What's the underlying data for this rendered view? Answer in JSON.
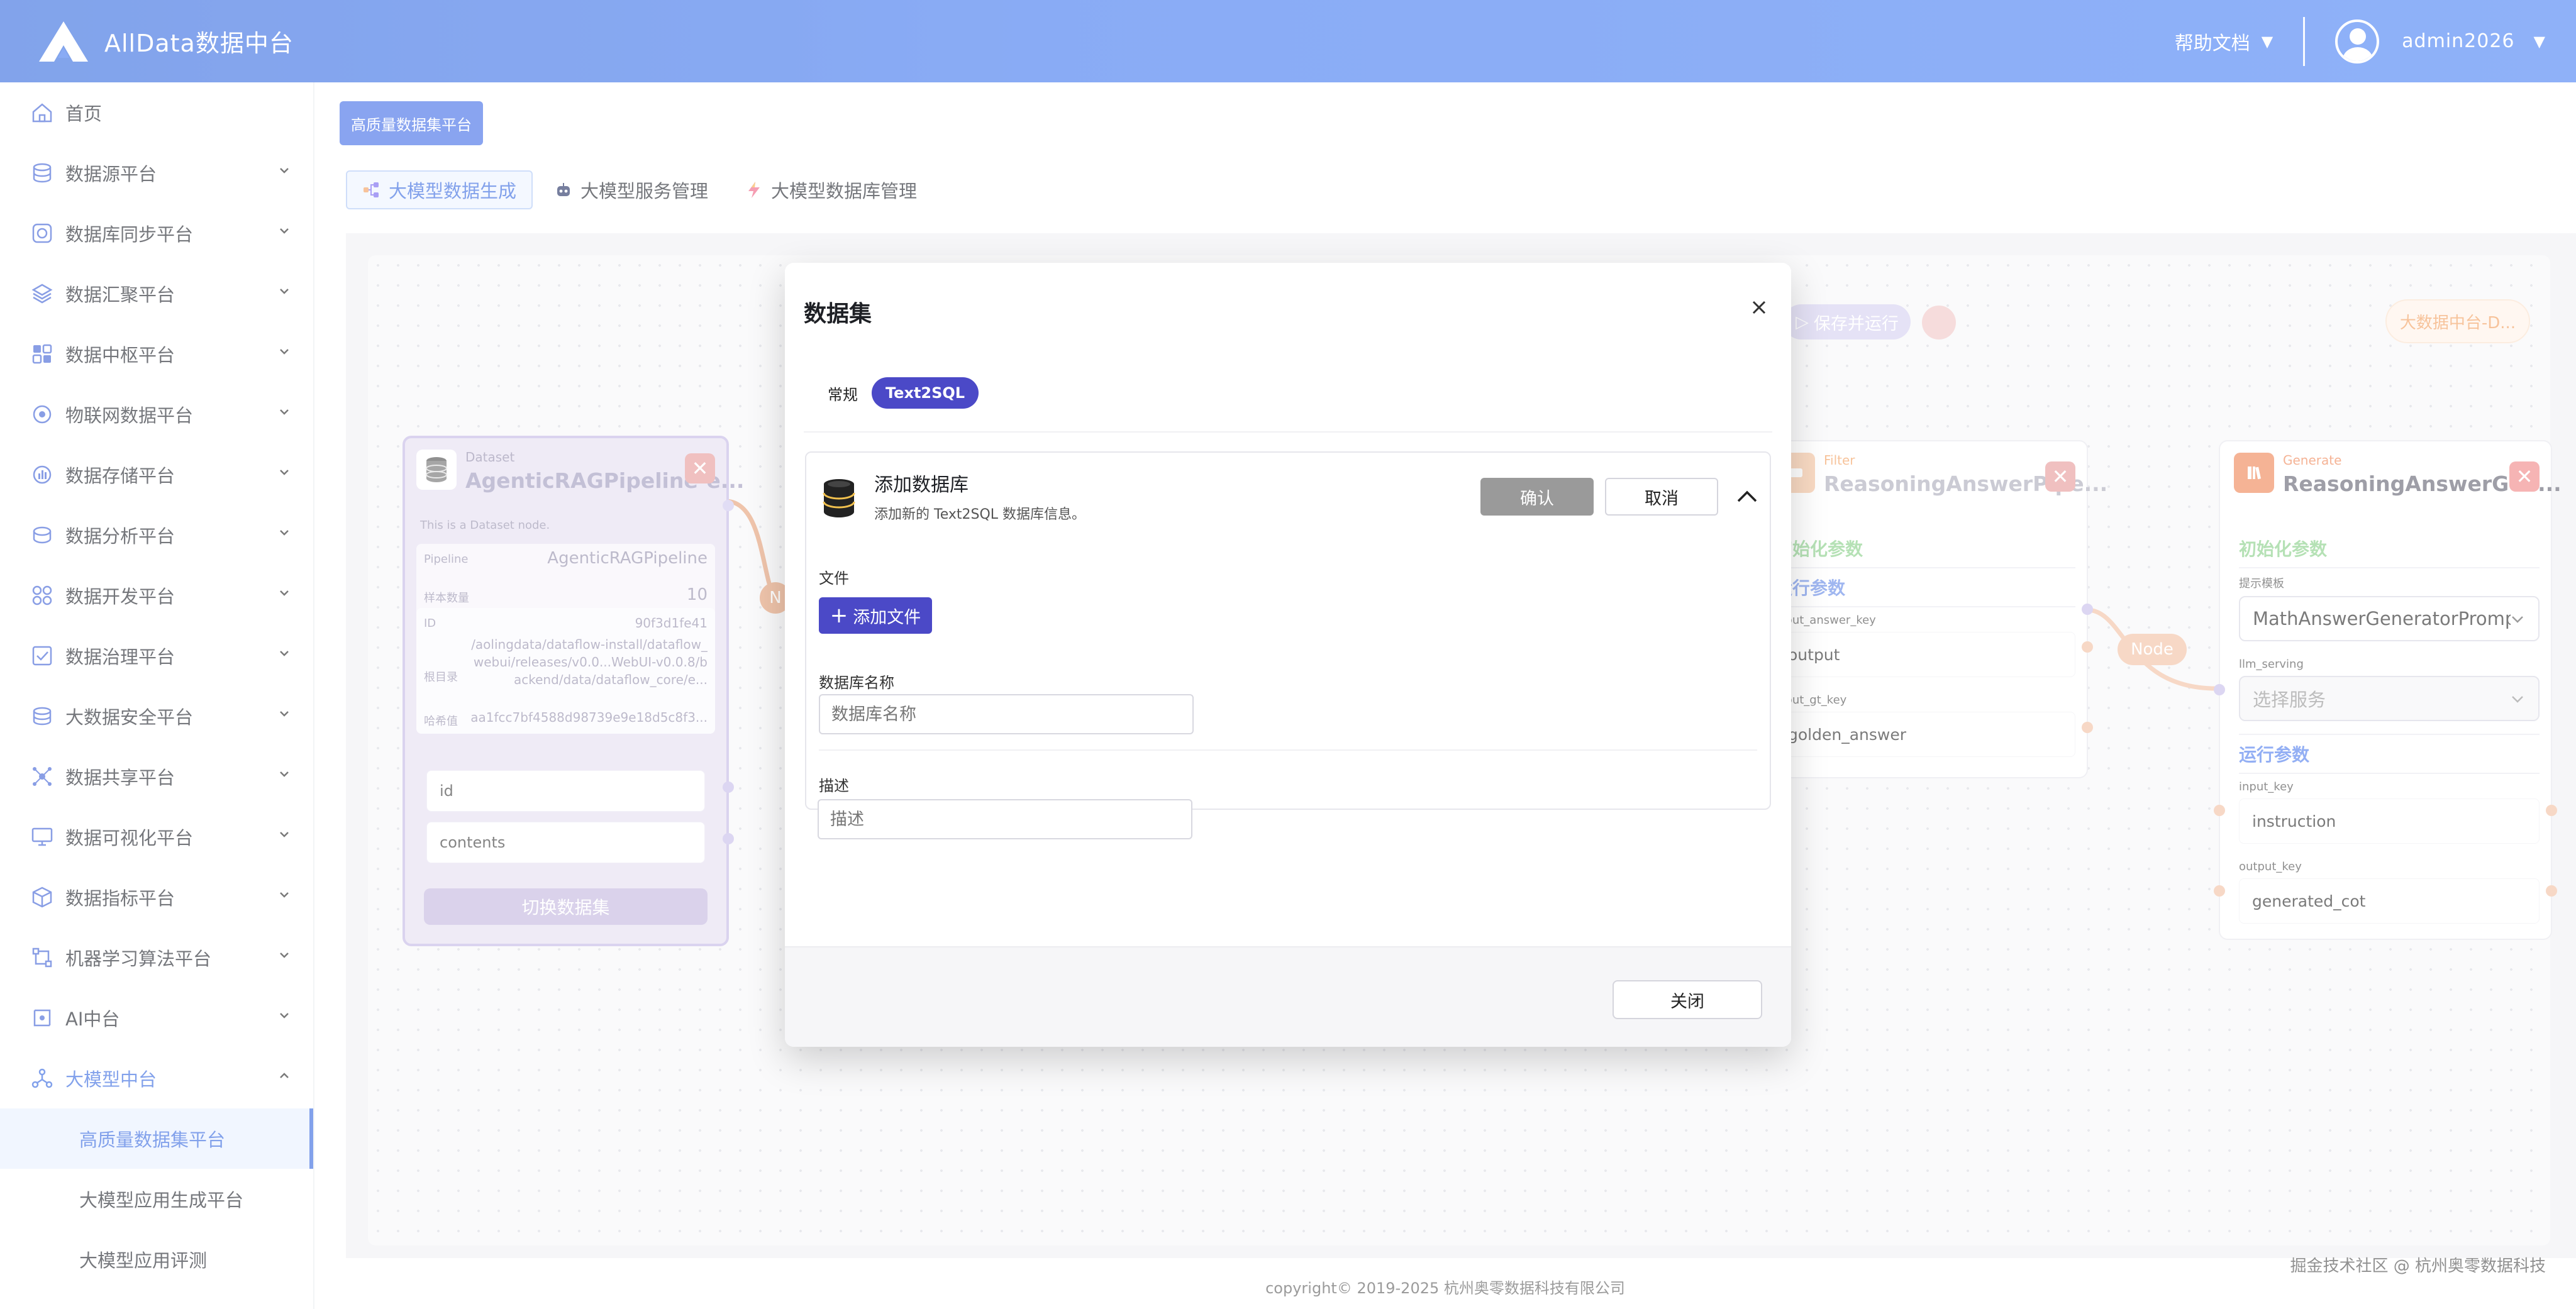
{
  "header": {
    "title": "AllData数据中台",
    "help_label": "帮助文档",
    "username": "admin2026"
  },
  "sidebar": {
    "items": [
      {
        "label": "首页",
        "icon": "home-icon"
      },
      {
        "label": "数据源平台",
        "icon": "database-icon"
      },
      {
        "label": "数据库同步平台",
        "icon": "sync-icon"
      },
      {
        "label": "数据汇聚平台",
        "icon": "layers-icon"
      },
      {
        "label": "数据中枢平台",
        "icon": "grid-icon"
      },
      {
        "label": "物联网数据平台",
        "icon": "iot-icon"
      },
      {
        "label": "数据存储平台",
        "icon": "storage-icon"
      },
      {
        "label": "数据分析平台",
        "icon": "analysis-icon"
      },
      {
        "label": "数据开发平台",
        "icon": "apps-icon"
      },
      {
        "label": "数据治理平台",
        "icon": "governance-icon"
      },
      {
        "label": "大数据安全平台",
        "icon": "security-icon"
      },
      {
        "label": "数据共享平台",
        "icon": "share-icon"
      },
      {
        "label": "数据可视化平台",
        "icon": "monitor-icon"
      },
      {
        "label": "数据指标平台",
        "icon": "cube-icon"
      },
      {
        "label": "机器学习算法平台",
        "icon": "ml-icon"
      },
      {
        "label": "AI中台",
        "icon": "ai-icon"
      },
      {
        "label": "大模型中台",
        "icon": "llm-icon"
      }
    ],
    "sub_items": [
      {
        "label": "高质量数据集平台"
      },
      {
        "label": "大模型应用生成平台"
      },
      {
        "label": "大模型应用评测"
      }
    ]
  },
  "main": {
    "tag_button": "高质量数据集平台",
    "tabs": [
      {
        "label": "大模型数据生成"
      },
      {
        "label": "大模型服务管理"
      },
      {
        "label": "大模型数据库管理"
      }
    ]
  },
  "canvas": {
    "save_run_label": "保存并运行",
    "right_tag": "大数据中台-D...",
    "dataset_node": {
      "type": "Dataset",
      "name": "AgenticRAGPipeline-e...",
      "desc": "This is a Dataset node.",
      "pipeline_label": "Pipeline",
      "pipeline_value": "AgenticRAGPipeline",
      "sample_label": "样本数量",
      "sample_value": "10",
      "id_label": "ID",
      "id_value": "90f3d1fe41",
      "root_label": "根目录",
      "root_value": "/aolingdata/dataflow-install/dataflow_webui/releases/v0.0...WebUI-v0.0.8/backend/data/dataflow_core/e...",
      "hash_label": "哈希值",
      "hash_value": "aa1fcc7bf4588d98739e9e18d5c8f3...",
      "fields": [
        "id",
        "contents"
      ],
      "switch_label": "切换数据集"
    },
    "filter_node": {
      "type": "Filter",
      "name": "ReasoningAnswerPipe...",
      "init_params": "初始化参数",
      "run_params": "运行参数",
      "k1": "input_answer_key",
      "v1": "output",
      "k2": "input_gt_key",
      "v2": "golden_answer"
    },
    "generate_node": {
      "type": "Generate",
      "name": "ReasoningAnswerGen...",
      "init_params": "初始化参数",
      "prompt_label": "提示模板",
      "prompt_value": "MathAnswerGeneratorPromp",
      "serving_label": "llm_serving",
      "serving_placeholder": "选择服务",
      "run_params": "运行参数",
      "k1": "input_key",
      "v1": "instruction",
      "k2": "output_key",
      "v2": "generated_cot"
    },
    "node_pill_label": "Node",
    "left_pill_label": "N"
  },
  "modal": {
    "title": "数据集",
    "tabs": [
      {
        "label": "常规"
      },
      {
        "label": "Text2SQL"
      }
    ],
    "card": {
      "title": "添加数据库",
      "desc": "添加新的 Text2SQL 数据库信息。",
      "confirm": "确认",
      "cancel": "取消",
      "file_label": "文件",
      "add_file": "添加文件",
      "db_name_label": "数据库名称",
      "db_name_placeholder": "数据库名称",
      "desc_label": "描述",
      "desc_placeholder": "描述"
    },
    "close_label": "关闭"
  },
  "footer": {
    "copyright": "copyright© 2019-2025 杭州奥零数据科技有限公司",
    "watermark": "掘金技术社区 @ 杭州奥零数据科技"
  },
  "colors": {
    "primary": "#4b7ff0",
    "accent": "#4b49c7",
    "dataset_node": "#c7bce6",
    "filter_orange": "#f3a466",
    "generate_orange": "#f08a5d"
  }
}
